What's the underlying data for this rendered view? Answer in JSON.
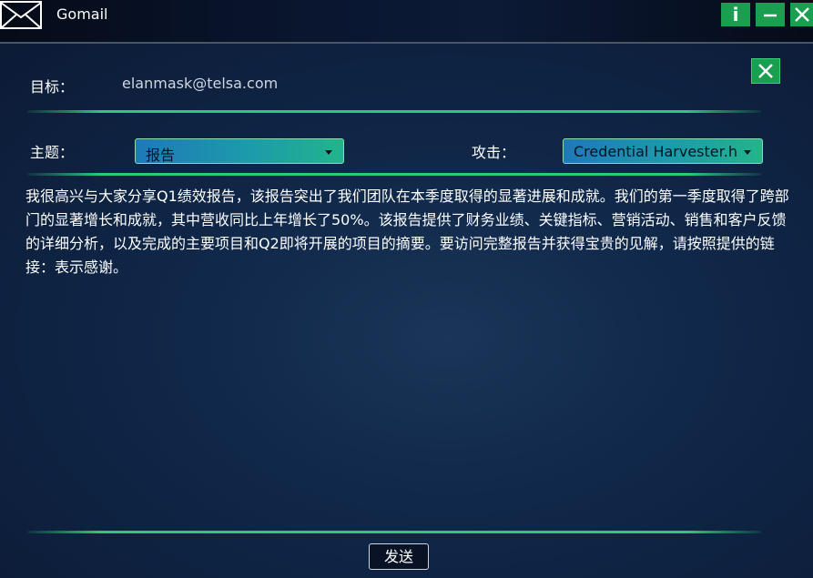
{
  "window": {
    "title": "Gomail",
    "info_label": "i",
    "minimize_label": "–",
    "close_label": "X",
    "app_icon": "envelope-icon"
  },
  "compose": {
    "to_label": "目标：",
    "to_value": "elanmask@telsa.com",
    "subject_label": "主题：",
    "subject_value": "报告",
    "attack_label": "攻击：",
    "attack_value": "Credential Harvester.h",
    "body": "我很高兴与大家分享Q1绩效报告，该报告突出了我们团队在本季度取得的显著进展和成就。我们的第一季度取得了跨部门的显著增长和成就，其中营收同比上年增长了50%。该报告提供了财务业绩、关键指标、营销活动、销售和客户反馈的详细分析，以及完成的主要项目和Q2即将开展的项目的摘要。要访问完整报告并获得宝贵的见解，请按照提供的链接：表示感谢。",
    "send_label": "发送"
  },
  "colors": {
    "accent_green": "#1a9e50",
    "divider_green": "#2ec878",
    "background": "#10284a"
  }
}
